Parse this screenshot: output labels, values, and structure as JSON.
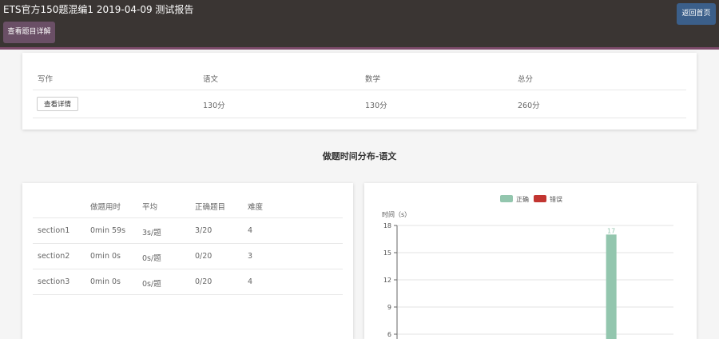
{
  "header": {
    "title": "ETS官方150题混编1 2019-04-09 测试报告",
    "detail_button": "查看题目详解",
    "home_button": "返回首页"
  },
  "scores": {
    "headers": [
      "写作",
      "语文",
      "数学",
      "总分"
    ],
    "writing_button": "查看详情",
    "values": [
      "130分",
      "130分",
      "260分"
    ]
  },
  "section_title": "做题时间分布-语文",
  "sections_table": {
    "headers": [
      "",
      "做题用时",
      "平均",
      "正确题目",
      "难度"
    ],
    "rows": [
      [
        "section1",
        "0min 59s",
        "3s/题",
        "3/20",
        "4"
      ],
      [
        "section2",
        "0min 0s",
        "0s/题",
        "0/20",
        "3"
      ],
      [
        "section3",
        "0min 0s",
        "0s/题",
        "0/20",
        "4"
      ]
    ]
  },
  "chart_data": {
    "type": "bar",
    "ylabel": "时间（s）",
    "yticks": [
      "6",
      "9",
      "12",
      "15",
      "18"
    ],
    "ylim": [
      0,
      18
    ],
    "legend": [
      {
        "name": "正确",
        "color": "#93c6ae"
      },
      {
        "name": "错误",
        "color": "#c23531"
      }
    ],
    "series": [
      {
        "name": "正确",
        "values": [
          0,
          0,
          0,
          0,
          0,
          0,
          0,
          0,
          0,
          0,
          0,
          0,
          0,
          0,
          0,
          17,
          0,
          0,
          0,
          0
        ]
      }
    ],
    "data_labels": [
      "17"
    ]
  }
}
